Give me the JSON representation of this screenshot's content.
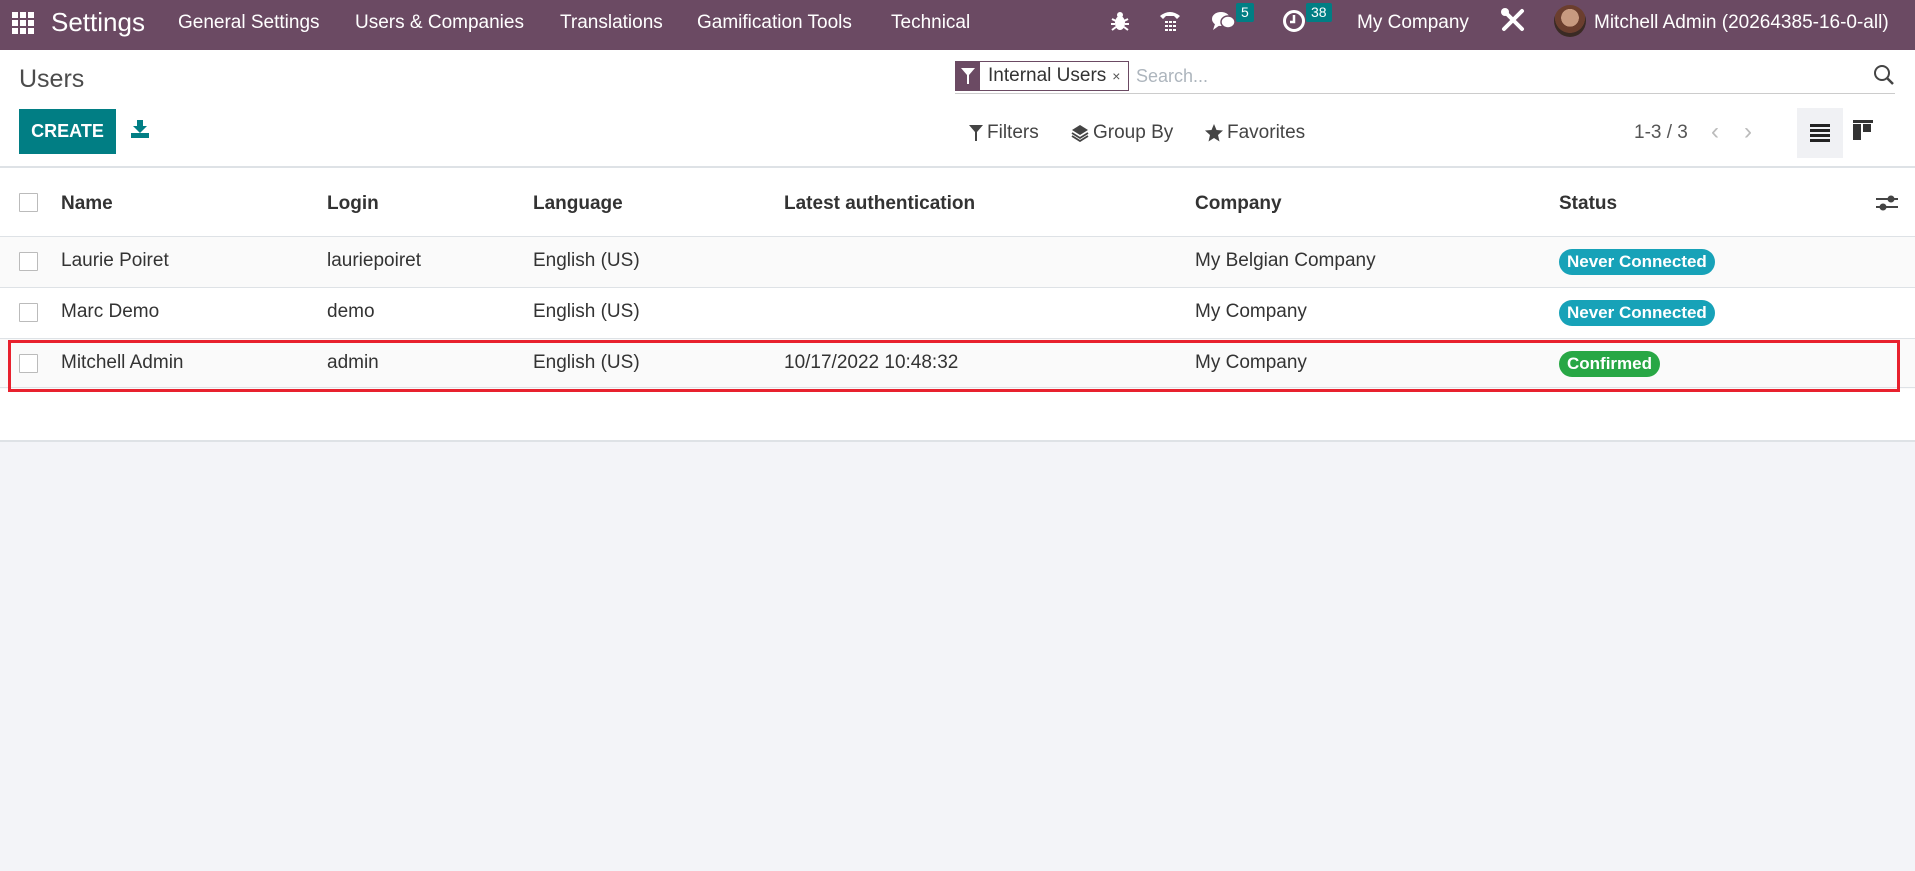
{
  "navbar": {
    "app_name": "Settings",
    "menu": [
      "General Settings",
      "Users & Companies",
      "Translations",
      "Gamification Tools",
      "Technical"
    ],
    "messages_count": "5",
    "activities_count": "38",
    "company": "My Company",
    "user": "Mitchell Admin (20264385-16-0-all)"
  },
  "control_panel": {
    "title": "Users",
    "create_label": "CREATE",
    "facet_label": "Internal Users",
    "facet_remove": "×",
    "search_placeholder": "Search...",
    "filters_label": "Filters",
    "groupby_label": "Group By",
    "favorites_label": "Favorites",
    "pager": "1-3 / 3",
    "pager_prev": "‹",
    "pager_next": "›"
  },
  "table": {
    "columns": [
      "Name",
      "Login",
      "Language",
      "Latest authentication",
      "Company",
      "Status"
    ],
    "rows": [
      {
        "name": "Laurie Poiret",
        "login": "lauriepoiret",
        "language": "English (US)",
        "latest_auth": "",
        "company": "My Belgian Company",
        "status": "Never Connected",
        "status_color": "#17a2b8"
      },
      {
        "name": "Marc Demo",
        "login": "demo",
        "language": "English (US)",
        "latest_auth": "",
        "company": "My Company",
        "status": "Never Connected",
        "status_color": "#17a2b8"
      },
      {
        "name": "Mitchell Admin",
        "login": "admin",
        "language": "English (US)",
        "latest_auth": "10/17/2022 10:48:32",
        "company": "My Company",
        "status": "Confirmed",
        "status_color": "#28a745"
      }
    ]
  },
  "colors": {
    "navbar": "#6b4a63",
    "primary": "#017e84",
    "highlight_box": "#e8212e"
  }
}
